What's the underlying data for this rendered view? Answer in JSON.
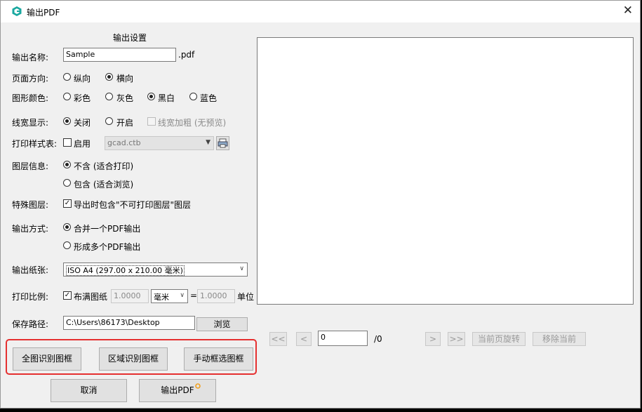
{
  "window": {
    "title": "输出PDF",
    "close_glyph": "✕"
  },
  "settings": {
    "heading": "输出设置",
    "output_name": {
      "label": "输出名称:",
      "value": "Sample",
      "suffix": ".pdf"
    },
    "orientation": {
      "label": "页面方向:",
      "options": [
        "纵向",
        "横向"
      ],
      "selected": "横向"
    },
    "color": {
      "label": "图形颜色:",
      "options": [
        "彩色",
        "灰色",
        "黑白",
        "蓝色"
      ],
      "selected": "黑白"
    },
    "line_width": {
      "label": "线宽显示:",
      "options": [
        "关闭",
        "开启"
      ],
      "selected": "关闭",
      "bold_option": "线宽加粗 (无预览)"
    },
    "plot_style": {
      "label": "打印样式表:",
      "enable_label": "启用",
      "file": "gcad.ctb"
    },
    "layer_info": {
      "label": "图层信息:",
      "options": [
        "不含 (适合打印)",
        "包含 (适合浏览)"
      ],
      "selected": "不含 (适合打印)"
    },
    "special_layer": {
      "label": "特殊图层:",
      "checkbox_label": "导出时包含\"不可打印图层\"图层"
    },
    "output_mode": {
      "label": "输出方式:",
      "options": [
        "合并一个PDF输出",
        "形成多个PDF输出"
      ],
      "selected": "合并一个PDF输出"
    },
    "paper": {
      "label": "输出纸张:",
      "value": "ISO A4 (297.00 x 210.00 毫米)"
    },
    "scale": {
      "label": "打印比例:",
      "fit_label": "布满图纸",
      "value1": "1.0000",
      "unit": "毫米",
      "equals": "=",
      "value2": "1.0000",
      "unit_label": "单位"
    },
    "save_path": {
      "label": "保存路径:",
      "value": "C:\\Users\\86173\\Desktop",
      "browse": "浏览"
    }
  },
  "frame_buttons": [
    "全图识别图框",
    "区域识别图框",
    "手动框选图框"
  ],
  "actions": {
    "cancel": "取消",
    "export": "输出PDF"
  },
  "pager": {
    "first": "<<",
    "prev": "<",
    "page": "0",
    "total": "/0",
    "next": ">",
    "last": ">>",
    "rotate": "当前页旋转",
    "remove": "移除当前"
  },
  "colors": {
    "accent_red": "#e53030",
    "icon_teal": "#1aa8a0"
  }
}
